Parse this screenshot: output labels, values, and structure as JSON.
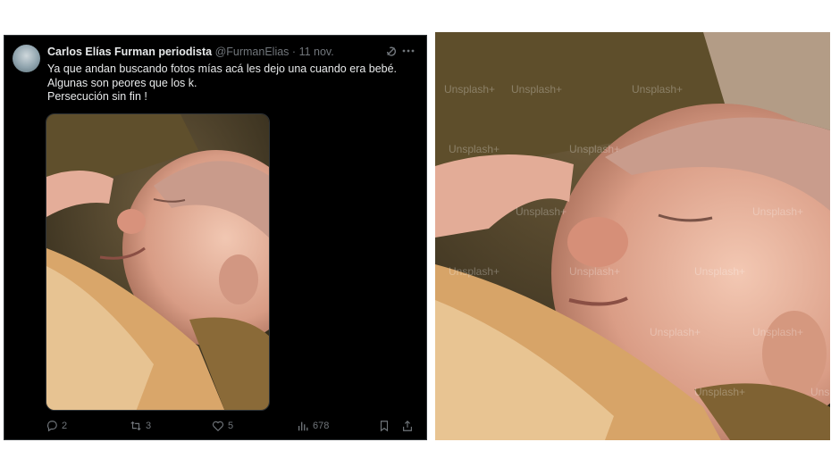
{
  "tweet": {
    "author_name": "Carlos Elías Furman periodista",
    "handle": "@FurmanElias",
    "separator": "·",
    "date": "11 nov.",
    "lines": [
      "Ya que andan buscando fotos mías acá les dejo una cuando era bebé.",
      "Algunas son peores que los k.",
      "Persecución sin fin !"
    ],
    "replies": "2",
    "retweets": "3",
    "likes": "5",
    "views": "678"
  },
  "watermark": "Unsplash+",
  "icons": [
    "grok-icon",
    "more-icon",
    "reply-icon",
    "retweet-icon",
    "like-icon",
    "views-icon",
    "bookmark-icon",
    "share-icon"
  ],
  "colors": {
    "tweet_bg": "#000000",
    "text": "#e7e9ea",
    "muted": "#71767b",
    "border": "#2f3336"
  }
}
